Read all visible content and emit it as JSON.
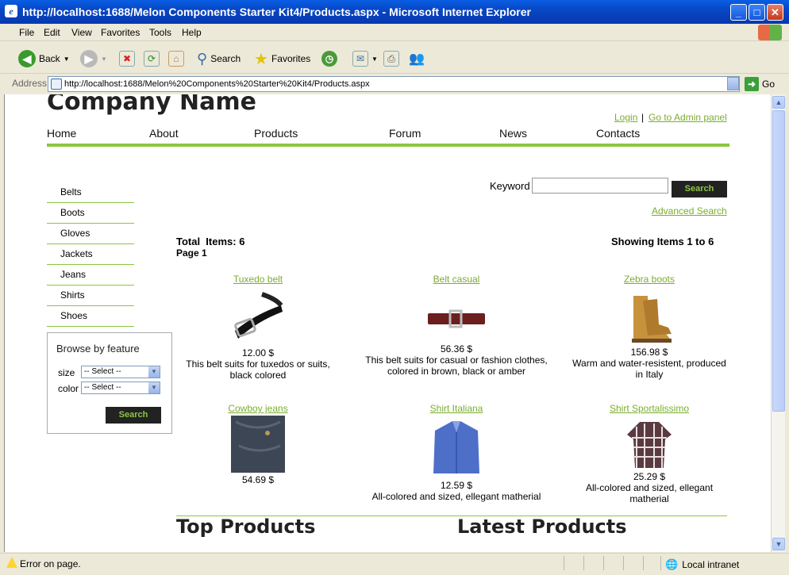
{
  "window": {
    "title": "http://localhost:1688/Melon Components Starter Kit4/Products.aspx - Microsoft Internet Explorer"
  },
  "menu": [
    "File",
    "Edit",
    "View",
    "Favorites",
    "Tools",
    "Help"
  ],
  "toolbar": {
    "back": "Back",
    "search": "Search",
    "favorites": "Favorites"
  },
  "address": {
    "label": "Address",
    "url": "http://localhost:1688/Melon%20Components%20Starter%20Kit4/Products.aspx",
    "go": "Go"
  },
  "page": {
    "company": "Company Name",
    "login": "Login",
    "separator": "|",
    "admin": "Go to Admin panel",
    "nav": [
      "Home",
      "About",
      "Products",
      "Forum",
      "News",
      "Contacts"
    ],
    "categories": [
      "Belts",
      "Boots",
      "Gloves",
      "Jackets",
      "Jeans",
      "Shirts",
      "Shoes"
    ],
    "browse": {
      "title": "Browse by feature",
      "size_label": "size",
      "color_label": "color",
      "size_value": "-- Select --",
      "color_value": "-- Select --",
      "button": "Search"
    },
    "search": {
      "label": "Keyword",
      "button": "Search",
      "advanced": "Advanced Search"
    },
    "total": "Total  Items: 6",
    "page_no": "Page 1",
    "showing": "Showing Items 1 to 6",
    "products": [
      {
        "name": "Tuxedo belt",
        "price": "12.00 $",
        "desc": "This belt suits for tuxedos or suits, black colored"
      },
      {
        "name": "Belt casual",
        "price": "56.36 $",
        "desc": "This belt suits for casual or fashion clothes, colored in brown, black or amber"
      },
      {
        "name": "Zebra boots",
        "price": "156.98 $",
        "desc": "Warm and water-resistent, produced in Italy"
      },
      {
        "name": "Cowboy jeans",
        "price": "54.69 $",
        "desc": ""
      },
      {
        "name": "Shirt Italiana",
        "price": "12.59 $",
        "desc": "All-colored and sized, ellegant matherial"
      },
      {
        "name": "Shirt Sportalissimo",
        "price": "25.29 $",
        "desc": "All-colored and sized, ellegant matherial"
      }
    ],
    "top_products": "Top Products",
    "latest_products": "Latest Products"
  },
  "status": {
    "text": "Error on page.",
    "zone": "Local intranet"
  },
  "colors": {
    "accent": "#8cc63f",
    "link": "#7aae2d",
    "button_bg": "#222222"
  }
}
